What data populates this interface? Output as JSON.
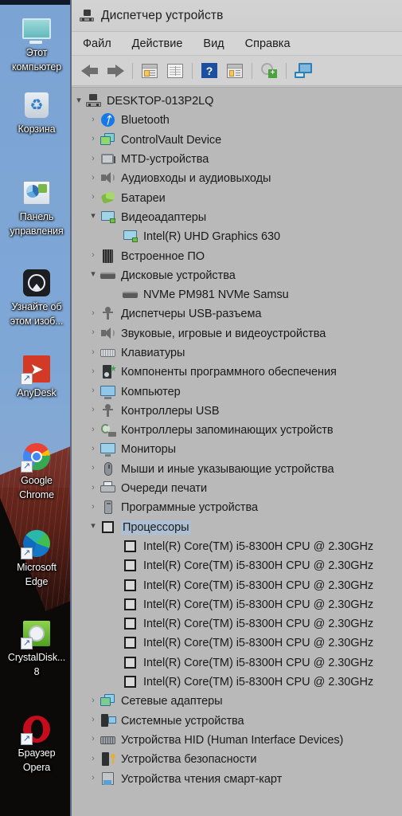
{
  "desktop": {
    "icons": [
      {
        "name": "this-pc",
        "glyph": "monitor-icon",
        "label_lines": [
          "Этот",
          "компьютер"
        ]
      },
      {
        "name": "recycle-bin",
        "glyph": "recycle-bin-icon",
        "label_lines": [
          "Корзина"
        ]
      },
      {
        "name": "control-panel",
        "glyph": "control-panel-icon",
        "label_lines": [
          "Панель",
          "управления"
        ]
      },
      {
        "name": "photos",
        "glyph": "photos-icon",
        "label_lines": [
          "Узнайте об",
          "этом изоб..."
        ]
      },
      {
        "name": "anydesk",
        "glyph": "anydesk-icon",
        "label_lines": [
          "AnyDesk"
        ]
      },
      {
        "name": "google-chrome",
        "glyph": "chrome-icon",
        "label_lines": [
          "Google",
          "Chrome"
        ]
      },
      {
        "name": "microsoft-edge",
        "glyph": "edge-icon",
        "label_lines": [
          "Microsoft",
          "Edge"
        ]
      },
      {
        "name": "crystaldiskinfo",
        "glyph": "crystaldisk-icon",
        "label_lines": [
          "CrystalDisk...",
          "8"
        ]
      },
      {
        "name": "opera-browser",
        "glyph": "opera-icon",
        "label_lines": [
          "Браузер",
          "Opera"
        ]
      }
    ]
  },
  "window": {
    "title": "Диспетчер устройств",
    "title_icon": "device-manager-icon",
    "menu": [
      {
        "label": "Файл"
      },
      {
        "label": "Действие"
      },
      {
        "label": "Вид"
      },
      {
        "label": "Справка"
      }
    ],
    "toolbar": [
      {
        "name": "back-button",
        "icon": "arrow-left-icon"
      },
      {
        "name": "forward-button",
        "icon": "arrow-right-icon"
      },
      {
        "name": "show-hide-console-tree-button",
        "icon": "console-tree-icon"
      },
      {
        "name": "show-hide-action-pane-button",
        "icon": "action-pane-icon"
      },
      {
        "name": "help-button",
        "icon": "help-icon"
      },
      {
        "name": "properties-button",
        "icon": "properties-icon"
      },
      {
        "name": "update-driver-button",
        "icon": "update-driver-icon"
      },
      {
        "name": "scan-hardware-changes-button",
        "icon": "scan-monitors-icon"
      }
    ],
    "selection_color": "#aebfd4",
    "tree_background": "#b9b9b9"
  },
  "tree": {
    "root": {
      "label": "DESKTOP-013P2LQ",
      "icon": "computer-node-icon",
      "expanded": true,
      "chevron": "chevron-down-icon"
    },
    "nodes": [
      {
        "label": "Bluetooth",
        "icon": "bluetooth-icon",
        "indent": 1,
        "expanded": false,
        "selected": false
      },
      {
        "label": "ControlVault Device",
        "icon": "controlvault-icon",
        "indent": 1,
        "expanded": false,
        "selected": false
      },
      {
        "label": "MTD-устройства",
        "icon": "mtd-icon",
        "indent": 1,
        "expanded": false,
        "selected": false
      },
      {
        "label": "Аудиовходы и аудиовыходы",
        "icon": "audio-icon",
        "indent": 1,
        "expanded": false,
        "selected": false
      },
      {
        "label": "Батареи",
        "icon": "battery-icon",
        "indent": 1,
        "expanded": false,
        "selected": false
      },
      {
        "label": "Видеоадаптеры",
        "icon": "display-adapter-icon",
        "indent": 1,
        "expanded": true,
        "selected": false
      },
      {
        "label": "Intel(R) UHD Graphics 630",
        "icon": "display-adapter-icon",
        "indent": 2,
        "expanded": null,
        "selected": false
      },
      {
        "label": "Встроенное ПО",
        "icon": "firmware-icon",
        "indent": 1,
        "expanded": false,
        "selected": false
      },
      {
        "label": "Дисковые устройства",
        "icon": "disk-drive-icon",
        "indent": 1,
        "expanded": true,
        "selected": false
      },
      {
        "label": "NVMe PM981 NVMe Samsu",
        "icon": "disk-drive-icon",
        "indent": 2,
        "expanded": null,
        "selected": false
      },
      {
        "label": "Диспетчеры USB-разъема",
        "icon": "usb-icon",
        "indent": 1,
        "expanded": false,
        "selected": false
      },
      {
        "label": "Звуковые, игровые и видеоустройства",
        "icon": "audio-icon",
        "indent": 1,
        "expanded": false,
        "selected": false
      },
      {
        "label": "Клавиатуры",
        "icon": "keyboard-icon",
        "indent": 1,
        "expanded": false,
        "selected": false
      },
      {
        "label": "Компоненты программного обеспечения",
        "icon": "software-component-icon",
        "indent": 1,
        "expanded": false,
        "selected": false
      },
      {
        "label": "Компьютер",
        "icon": "computer-icon",
        "indent": 1,
        "expanded": false,
        "selected": false
      },
      {
        "label": "Контроллеры USB",
        "icon": "usb-icon",
        "indent": 1,
        "expanded": false,
        "selected": false
      },
      {
        "label": "Контроллеры запоминающих устройств",
        "icon": "storage-controller-icon",
        "indent": 1,
        "expanded": false,
        "selected": false
      },
      {
        "label": "Мониторы",
        "icon": "monitor-icon",
        "indent": 1,
        "expanded": false,
        "selected": false
      },
      {
        "label": "Мыши и иные указывающие устройства",
        "icon": "mouse-icon",
        "indent": 1,
        "expanded": false,
        "selected": false
      },
      {
        "label": "Очереди печати",
        "icon": "printer-icon",
        "indent": 1,
        "expanded": false,
        "selected": false
      },
      {
        "label": "Программные устройства",
        "icon": "software-device-icon",
        "indent": 1,
        "expanded": false,
        "selected": false
      },
      {
        "label": "Процессоры",
        "icon": "processor-icon",
        "indent": 1,
        "expanded": true,
        "selected": true
      },
      {
        "label": "Intel(R) Core(TM) i5-8300H CPU @ 2.30GHz",
        "icon": "processor-icon",
        "indent": 2,
        "expanded": null,
        "selected": false
      },
      {
        "label": "Intel(R) Core(TM) i5-8300H CPU @ 2.30GHz",
        "icon": "processor-icon",
        "indent": 2,
        "expanded": null,
        "selected": false
      },
      {
        "label": "Intel(R) Core(TM) i5-8300H CPU @ 2.30GHz",
        "icon": "processor-icon",
        "indent": 2,
        "expanded": null,
        "selected": false
      },
      {
        "label": "Intel(R) Core(TM) i5-8300H CPU @ 2.30GHz",
        "icon": "processor-icon",
        "indent": 2,
        "expanded": null,
        "selected": false
      },
      {
        "label": "Intel(R) Core(TM) i5-8300H CPU @ 2.30GHz",
        "icon": "processor-icon",
        "indent": 2,
        "expanded": null,
        "selected": false
      },
      {
        "label": "Intel(R) Core(TM) i5-8300H CPU @ 2.30GHz",
        "icon": "processor-icon",
        "indent": 2,
        "expanded": null,
        "selected": false
      },
      {
        "label": "Intel(R) Core(TM) i5-8300H CPU @ 2.30GHz",
        "icon": "processor-icon",
        "indent": 2,
        "expanded": null,
        "selected": false
      },
      {
        "label": "Intel(R) Core(TM) i5-8300H CPU @ 2.30GHz",
        "icon": "processor-icon",
        "indent": 2,
        "expanded": null,
        "selected": false
      },
      {
        "label": "Сетевые адаптеры",
        "icon": "network-adapter-icon",
        "indent": 1,
        "expanded": false,
        "selected": false
      },
      {
        "label": "Системные устройства",
        "icon": "system-device-icon",
        "indent": 1,
        "expanded": false,
        "selected": false
      },
      {
        "label": "Устройства HID (Human Interface Devices)",
        "icon": "hid-icon",
        "indent": 1,
        "expanded": false,
        "selected": false
      },
      {
        "label": "Устройства безопасности",
        "icon": "security-device-icon",
        "indent": 1,
        "expanded": false,
        "selected": false
      },
      {
        "label": "Устройства чтения смарт-карт",
        "icon": "smartcard-reader-icon",
        "indent": 1,
        "expanded": false,
        "selected": false
      }
    ]
  }
}
